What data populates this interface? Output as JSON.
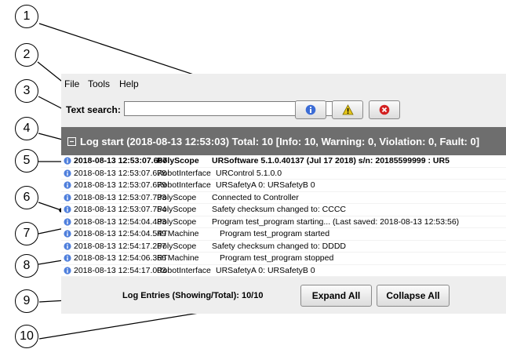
{
  "menu": {
    "file": "File",
    "tools": "Tools",
    "help": "Help"
  },
  "search": {
    "label": "Text search:",
    "value": ""
  },
  "filters": [
    {
      "name": "info-filter-button",
      "icon": "info-icon",
      "color": "#3b6cd6"
    },
    {
      "name": "warning-filter-button",
      "icon": "warning-icon",
      "color": "#e6c619"
    },
    {
      "name": "violation-filter-button",
      "icon": "error-icon",
      "color": "#d32020"
    }
  ],
  "log_header": "Log start (2018-08-13 12:53:03) Total: 10 [Info: 10, Warning: 0, Violation: 0, Fault: 0]",
  "log_entries": [
    {
      "timestamp": "2018-08-13 12:53:07.667",
      "source": "PolyScope",
      "message": "URSoftware 5.1.0.40137 (Jul 17 2018) s/n: 20185599999 : UR5"
    },
    {
      "timestamp": "2018-08-13 12:53:07.678",
      "source": "RobotInterface",
      "message": "URControl 5.1.0.0"
    },
    {
      "timestamp": "2018-08-13 12:53:07.679",
      "source": "RobotInterface",
      "message": "URSafetyA 0: URSafetyB 0"
    },
    {
      "timestamp": "2018-08-13 12:53:07.733",
      "source": "PolyScope",
      "message": "Connected to Controller"
    },
    {
      "timestamp": "2018-08-13 12:53:07.754",
      "source": "PolyScope",
      "message": "Safety checksum changed to: CCCC"
    },
    {
      "timestamp": "2018-08-13 12:54:04.483",
      "source": "PolyScope",
      "message": "Program test_program starting... (Last saved: 2018-08-13 12:53:56)"
    },
    {
      "timestamp": "2018-08-13 12:54:04.549",
      "source": "RTMachine",
      "message": "Program test_program started"
    },
    {
      "timestamp": "2018-08-13 12:54:17.267",
      "source": "PolyScope",
      "message": "Safety checksum changed to: DDDD"
    },
    {
      "timestamp": "2018-08-13 12:54:06.366",
      "source": "RTMachine",
      "message": "Program test_program stopped"
    },
    {
      "timestamp": "2018-08-13 12:54:17.003",
      "source": "RobotInterface",
      "message": "URSafetyA 0: URSafetyB 0"
    }
  ],
  "footer": {
    "entries_label": "Log Entries (Showing/Total): 10/10",
    "expand_label": "Expand All",
    "collapse_label": "Collapse All"
  },
  "callouts": [
    "1",
    "2",
    "3",
    "4",
    "5",
    "6",
    "7",
    "8",
    "9",
    "10"
  ]
}
